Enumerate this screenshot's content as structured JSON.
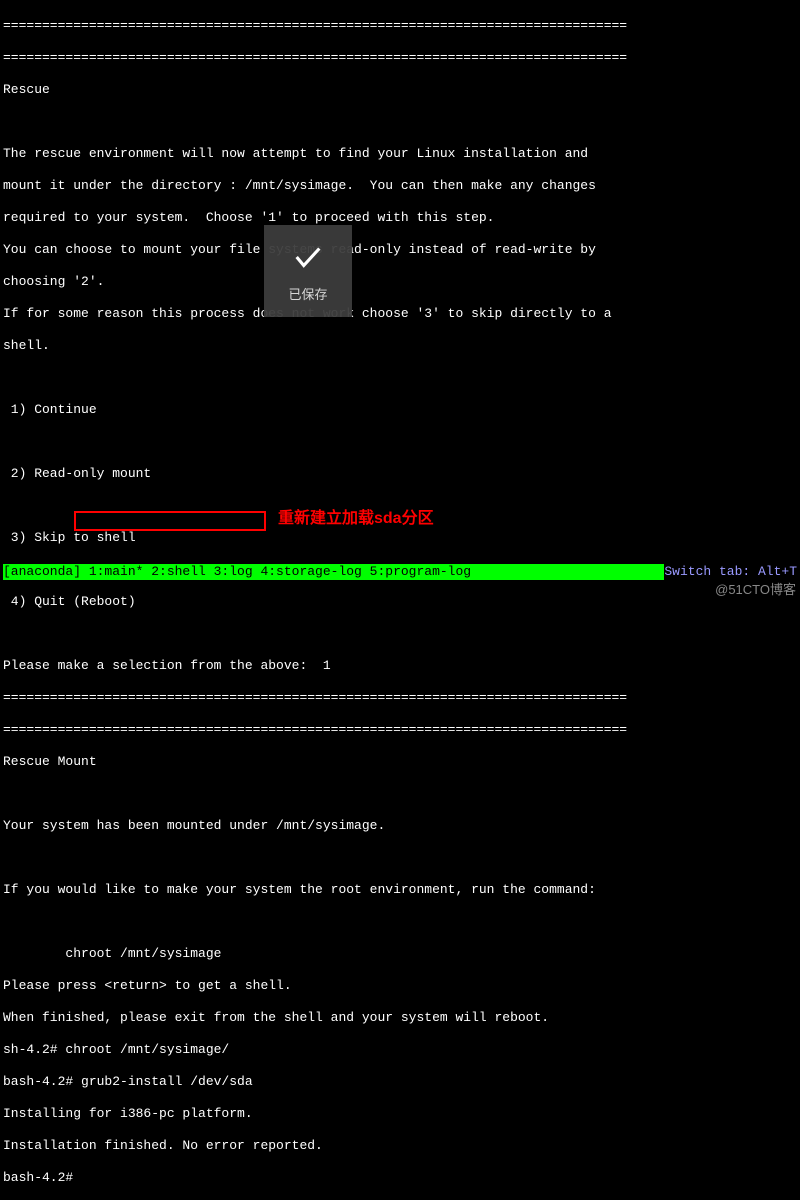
{
  "hr": "================================================================================",
  "rescue": {
    "title": "Rescue",
    "p1": "The rescue environment will now attempt to find your Linux installation and",
    "p2": "mount it under the directory : /mnt/sysimage.  You can then make any changes",
    "p3": "required to your system.  Choose '1' to proceed with this step.",
    "p4": "You can choose to mount your file systems read-only instead of read-write by",
    "p5": "choosing '2'.",
    "p6": "If for some reason this process does not work choose '3' to skip directly to a",
    "p7": "shell.",
    "opt1": " 1) Continue",
    "opt2": " 2) Read-only mount",
    "opt3": " 3) Skip to shell",
    "opt4": " 4) Quit (Reboot)",
    "prompt": "Please make a selection from the above:  1"
  },
  "mount": {
    "title": "Rescue Mount",
    "p1": "Your system has been mounted under /mnt/sysimage.",
    "p2": "If you would like to make your system the root environment, run the command:",
    "p3": "        chroot /mnt/sysimage",
    "p4": "Please press <return> to get a shell.",
    "p5": "When finished, please exit from the shell and your system will reboot."
  },
  "shell": {
    "l1": "sh-4.2# chroot /mnt/sysimage/",
    "l2": "bash-4.2# grub2-install /dev/sda",
    "l3": "Installing for i386-pc platform.",
    "l4": "Installation finished. No error reported.",
    "l5": "bash-4.2# "
  },
  "status": {
    "left": "[anaconda] 1:main* 2:shell  3:log  4:storage-log  5:program-log  ",
    "right": "Switch tab: Alt+T"
  },
  "annotation": {
    "text": "重新建立加载sda分区"
  },
  "toast": {
    "label": "已保存"
  },
  "watermark": "@51CTO博客"
}
